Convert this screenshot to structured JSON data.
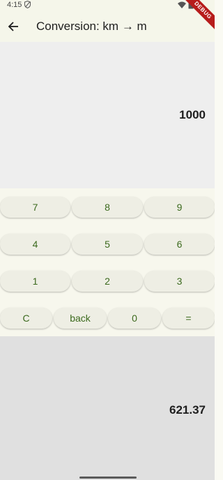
{
  "status_bar": {
    "time": "4:15",
    "icons": [
      "shield-icon",
      "wifi-icon",
      "battery-icon"
    ]
  },
  "debug_banner": "DEBUG",
  "app_bar": {
    "back_icon": "arrow-left-icon",
    "title": "Conversion: km → m"
  },
  "input_display": {
    "value": "1000"
  },
  "keypad": {
    "row1": [
      "7",
      "8",
      "9"
    ],
    "row2": [
      "4",
      "5",
      "6"
    ],
    "row3": [
      "1",
      "2",
      "3"
    ],
    "row4": [
      "C",
      "back",
      "0",
      "="
    ]
  },
  "result_display": {
    "value": "621.37"
  },
  "colors": {
    "key_text": "#3c6a1e",
    "key_bg": "#eeeee4",
    "app_bar_bg": "#f5f6ea",
    "debug_banner": "#b71c1c"
  }
}
